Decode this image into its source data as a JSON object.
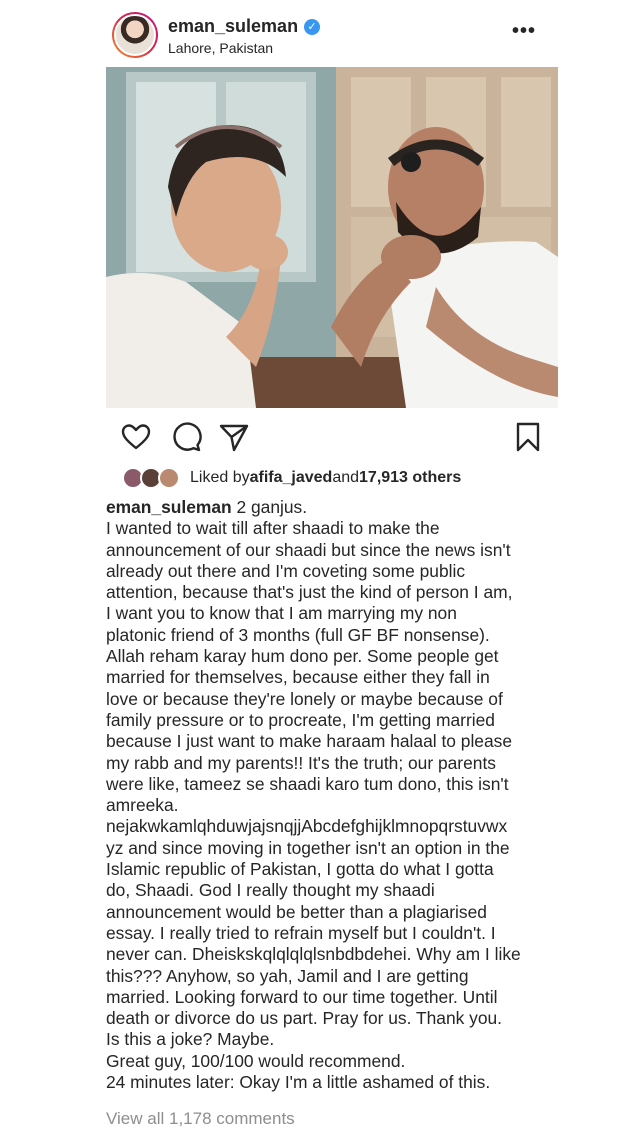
{
  "header": {
    "username": "eman_suleman",
    "location": "Lahore, Pakistan",
    "more_label": "•••"
  },
  "photo": {
    "description_icon": "photo"
  },
  "actions": {
    "like_icon": "heart-icon",
    "comment_icon": "comment-icon",
    "share_icon": "send-icon",
    "save_icon": "bookmark-icon"
  },
  "likes": {
    "prefix": "Liked by ",
    "user": "afifa_javed",
    "middle": " and ",
    "count": "17,913 others"
  },
  "caption": {
    "username": "eman_suleman",
    "first_line_rest": " 2 ganjus.",
    "lines": [
      "I wanted to wait till after shaadi to make the",
      "announcement of our shaadi but since the news isn't",
      "already out there and I'm coveting some public",
      "attention, because that's just the kind of person I am,",
      "I want you to know that I am marrying my non",
      "platonic friend of 3 months (full GF BF nonsense).",
      "Allah reham karay hum dono per. Some people get",
      "married for themselves, because either they fall in",
      "love or because they're lonely or maybe because of",
      "family pressure or to procreate, I'm getting married",
      "because I just want to make haraam halaal to please",
      "my rabb and my parents!! It's the truth; our parents",
      "were like, tameez se shaadi karo tum dono, this isn't",
      "amreeka.",
      "nejakwkamlqhduwjajsnqjjAbcdefghijklmnopqrstuvwx",
      "yz and since moving in together isn't an option in the",
      "Islamic republic of Pakistan, I gotta do what I gotta",
      "do, Shaadi. God I really thought my shaadi",
      "announcement would be better than a plagiarised",
      "essay. I really tried to refrain myself but I couldn't. I",
      "never can. Dheiskskqlqlqlqlsnbdbdehei. Why am I like",
      "this??? Anyhow, so yah, Jamil and I are getting",
      "married. Looking forward to our time together. Until",
      "death or divorce do us part. Pray for us. Thank you.",
      "Is this a joke? Maybe.",
      "Great guy, 100/100 would recommend.",
      "24 minutes later: Okay I'm a little ashamed of this."
    ]
  },
  "comments": {
    "view_all": "View all 1,178 comments"
  }
}
